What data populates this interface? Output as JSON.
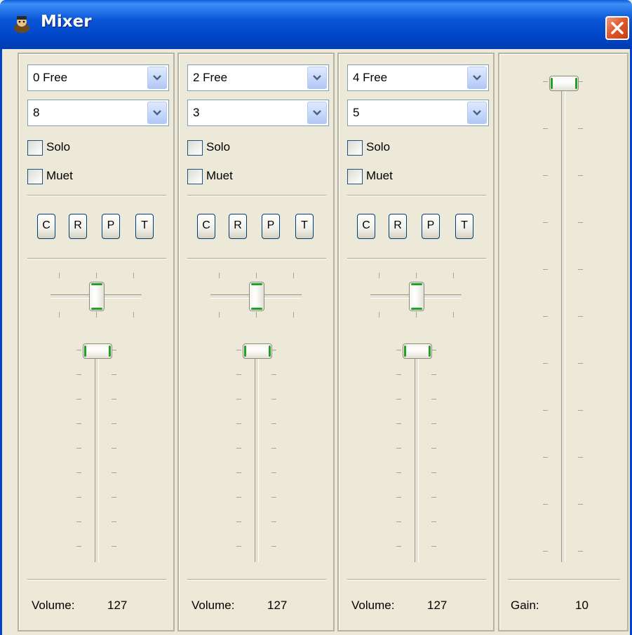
{
  "window": {
    "title": "Mixer",
    "icon": "app-icon",
    "close_icon": "close-icon"
  },
  "channels": [
    {
      "port": "0 Free",
      "channel": "8",
      "solo_label": "Solo",
      "mute_label": "Muet",
      "buttons": [
        "C",
        "R",
        "P",
        "T"
      ],
      "volume_label": "Volume:",
      "volume_value": "127"
    },
    {
      "port": "2 Free",
      "channel": "3",
      "solo_label": "Solo",
      "mute_label": "Muet",
      "buttons": [
        "C",
        "R",
        "P",
        "T"
      ],
      "volume_label": "Volume:",
      "volume_value": "127"
    },
    {
      "port": "4 Free",
      "channel": "5",
      "solo_label": "Solo",
      "mute_label": "Muet",
      "buttons": [
        "C",
        "R",
        "P",
        "T"
      ],
      "volume_label": "Volume:",
      "volume_value": "127"
    }
  ],
  "master": {
    "gain_label": "Gain:",
    "gain_value": "10"
  },
  "colors": {
    "titlebar": "#0045c8",
    "face": "#ece9d8",
    "thumb_accent": "#21a121",
    "close": "#e05a2e"
  }
}
